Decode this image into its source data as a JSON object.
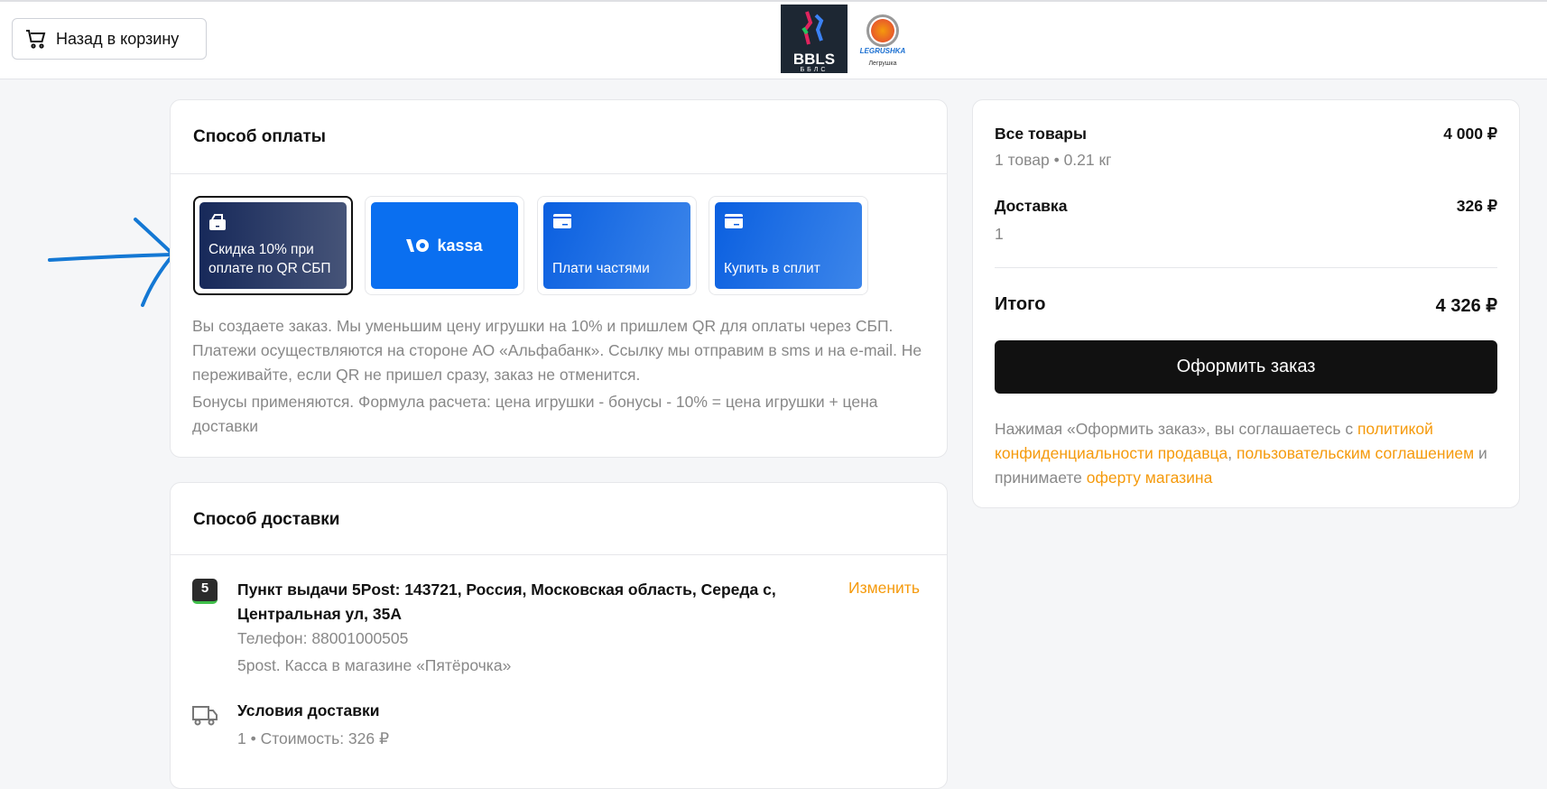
{
  "header": {
    "back_label": "Назад в корзину",
    "logo1_text": "BBLS",
    "logo1_sub": "ББЛС",
    "logo2_text": "LEGRUSHKA",
    "logo2_sub": "Легрушка"
  },
  "payment": {
    "title": "Способ оплаты",
    "options": [
      {
        "label": "Скидка 10% при оплате по QR СБП",
        "selected": true
      },
      {
        "label": "kassa",
        "selected": false
      },
      {
        "label": "Плати частями",
        "selected": false
      },
      {
        "label": "Купить в сплит",
        "selected": false
      }
    ],
    "description1": "Вы создаете заказ. Мы уменьшим цену игрушки на 10%  и пришлем QR для оплаты через СБП. Платежи осуществляются на стороне АО «Альфабанк». Ссылку мы отправим в sms и на e-mail. Не переживайте, если QR не пришел сразу, заказ не отменится.",
    "description2": "Бонусы применяются. Формула расчета: цена игрушки - бонусы - 10% = цена игрушки + цена доставки"
  },
  "delivery": {
    "title": "Способ доставки",
    "pickup_badge": "5",
    "address": "Пункт выдачи 5Post: 143721, Россия, Московская область, Середа с, Центральная ул, 35А",
    "change_label": "Изменить",
    "phone": "Телефон: 88001000505",
    "note": "5post. Касса в магазине «Пятёрочка»",
    "conditions_title": "Условия доставки",
    "conditions_value": "1 • Стоимость: 326 ₽"
  },
  "summary": {
    "items_label": "Все товары",
    "items_value": "4 000 ₽",
    "items_sub": "1 товар • 0.21 кг",
    "delivery_label": "Доставка",
    "delivery_value": "326 ₽",
    "delivery_sub": "1",
    "total_label": "Итого",
    "total_value": "4 326 ₽",
    "order_button": "Оформить заказ",
    "legal_1": "Нажимая «Оформить заказ», вы соглашаетесь с ",
    "legal_link1": "политикой конфиденциальности продавца",
    "legal_2": ", ",
    "legal_link2": "пользовательским соглашением",
    "legal_3": " и принимаете ",
    "legal_link3": "оферту магазина"
  },
  "colors": {
    "accent": "#f59a0c",
    "annotation_arrow": "#1478d4",
    "tile_blue": "#0a6ff0"
  }
}
